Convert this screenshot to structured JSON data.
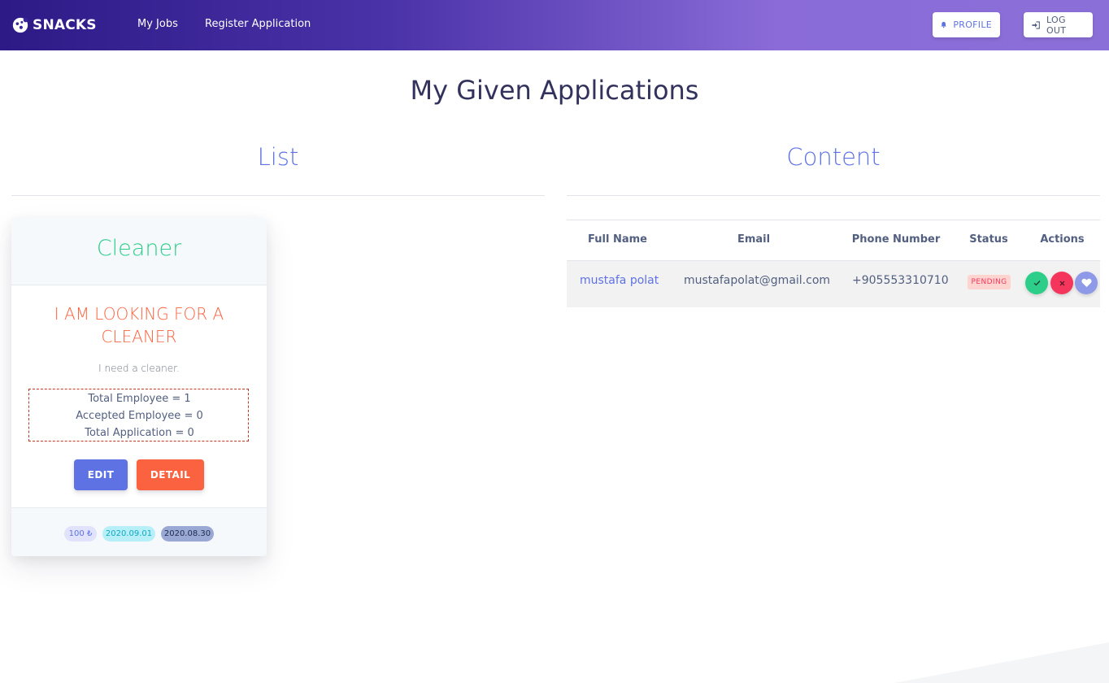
{
  "navbar": {
    "brand": "SNACKS",
    "links": [
      "My Jobs",
      "Register Application"
    ],
    "profile_label": "PROFILE",
    "logout_label": "LOG OUT"
  },
  "page": {
    "title": "My Given Applications",
    "list_title": "List",
    "content_title": "Content"
  },
  "card": {
    "header": "Cleaner",
    "job_title": "I AM LOOKING FOR A CLEANER",
    "description": "I need a cleaner.",
    "stats": [
      "Total Employee = 1",
      "Accepted Employee = 0",
      "Total Application = 0"
    ],
    "edit_label": "EDIT",
    "detail_label": "DETAIL",
    "badges": {
      "price": "100 ₺",
      "date_start": "2020.09.01",
      "date_end": "2020.08.30"
    }
  },
  "table": {
    "headers": [
      "Full Name",
      "Email",
      "Phone Number",
      "Status",
      "Actions"
    ],
    "rows": [
      {
        "full_name": "mustafa polat",
        "email": "mustafapolat@gmail.com",
        "phone": "+905553310710",
        "status": "PENDING"
      }
    ]
  },
  "colors": {
    "primary": "#5e72e4",
    "success": "#2dce89",
    "danger": "#f5365c",
    "warning": "#fb6340"
  },
  "icons": [
    "snacks-logo-icon",
    "bell-icon",
    "logout-icon",
    "check-icon",
    "times-icon",
    "heart-icon"
  ]
}
